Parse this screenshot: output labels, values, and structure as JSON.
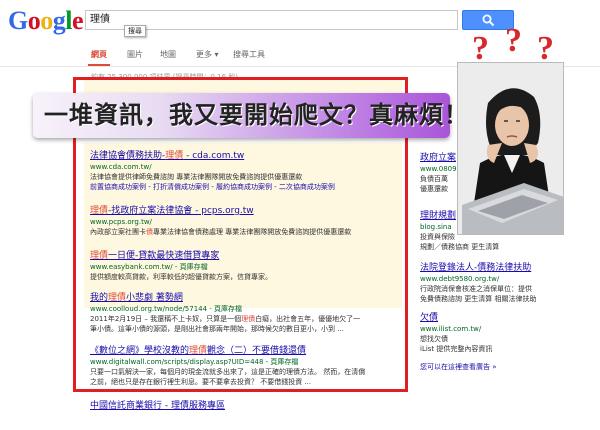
{
  "logo": {
    "letters": [
      "G",
      "o",
      "o",
      "g",
      "l",
      "e"
    ],
    "colors": [
      "#3369e8",
      "#d50f25",
      "#eeb211",
      "#3369e8",
      "#009925",
      "#d50f25"
    ]
  },
  "search": {
    "query": "理債",
    "tooltip": "搜尋"
  },
  "nav": {
    "items": [
      "網頁",
      "圖片",
      "地圖",
      "更多 ▾",
      "搜尋工具"
    ]
  },
  "stats": "約有 25,300,000 項結果 (搜尋時間：0.16 秒)",
  "banner": {
    "text": "一堆資訊，我又要開始爬文？真麻煩！"
  },
  "results": [
    {
      "title_pre": "法律協會債務扶助-",
      "title_hl": "理債",
      "title_post": " - cda.com.tw",
      "url": "www.cda.com.tw/",
      "desc": "法律協會提供律師免費諮詢 專業法律團隊開放免費諮詢提供優惠還款",
      "links": "前置協商成功案例 - 打折清償成功案例 - 履約協商成功案例 - 二次協商成功案例"
    },
    {
      "title_pre": "",
      "title_hl": "理債",
      "title_post": "-找政府立案法律協會 - pcps.org.tw",
      "url": "www.pcps.org.tw/",
      "desc_pre": "內政部立案社團卡",
      "desc_hl": "債",
      "desc_post": "專業法律協會債務處理 專業法律團隊開放免費諮詢提供優惠還款"
    },
    {
      "title_pre": "",
      "title_hl": "理債",
      "title_post": "一日便-貸款最快速借貸專家",
      "url": "www.easybank.com.tw/ - 頁庫存檔",
      "desc": "提供額度較高貸款，利率較低的超優貸款方案，信貸專家。"
    },
    {
      "title_pre": "我的",
      "title_hl": "理債",
      "title_post": "小悲劇 著勢網",
      "url": "www.coolloud.org.tw/node/57144 - 頁庫存檔",
      "desc_pre": "2011年2月19日 – 我還稱不上卡奴，只算是一個",
      "desc_hl": "理債",
      "desc_post": "白癡，出社會五年，優優地欠了一",
      "desc2": "筆小債。這筆小債的源頭，是剛出社會那兩年開始，那時候欠的數目更小，小到 ..."
    },
    {
      "title_pre": "《數位之網》學校沒教的",
      "title_hl": "理債",
      "title_post": "觀念（二）不要借錢還債",
      "url": "www.digitalwall.com/scripts/display.asp?UID=448 - 頁庫存檔",
      "desc": "只要一口氣解決一家，每個月的現金流就多出來了，這是正確的理債方法。 然而，在清償",
      "desc2": "之前，絕也只是存在銀行裡生利息。要不要拿去投資？ 不要借錢投資 ..."
    }
  ],
  "bottom_cut": "中國信託商業銀行 - 理債服務專區",
  "right_results": [
    {
      "title": "政府立案",
      "url": "www.0809",
      "desc": "負債百萬",
      "desc2": "優惠還款"
    },
    {
      "title": "理財規劃",
      "url": "blog.sina",
      "desc": "投資與保險",
      "desc2": "規劃／債務協商 更生清算"
    },
    {
      "title": "法院登錄法人-債務法律扶助",
      "url": "www.debt9580.org.tw/",
      "desc": "行政院消保會核准之消保單位：提供",
      "desc2": "免費債務諮詢 更生清算 相關法律扶助"
    },
    {
      "title": "欠債",
      "url": "www.ilist.com.tw/",
      "desc": "想找欠債",
      "desc2": "iList 提供完整內容資訊"
    }
  ],
  "right_more": "您可以在這裡查看廣告 »",
  "photo": {
    "question_marks": [
      "?",
      "?",
      "?"
    ]
  },
  "colors": {
    "accent_red": "#dd4b39",
    "frame_red": "#e02020",
    "link_blue": "#1a0dab",
    "url_green": "#006621",
    "search_blue": "#4d90fe"
  }
}
